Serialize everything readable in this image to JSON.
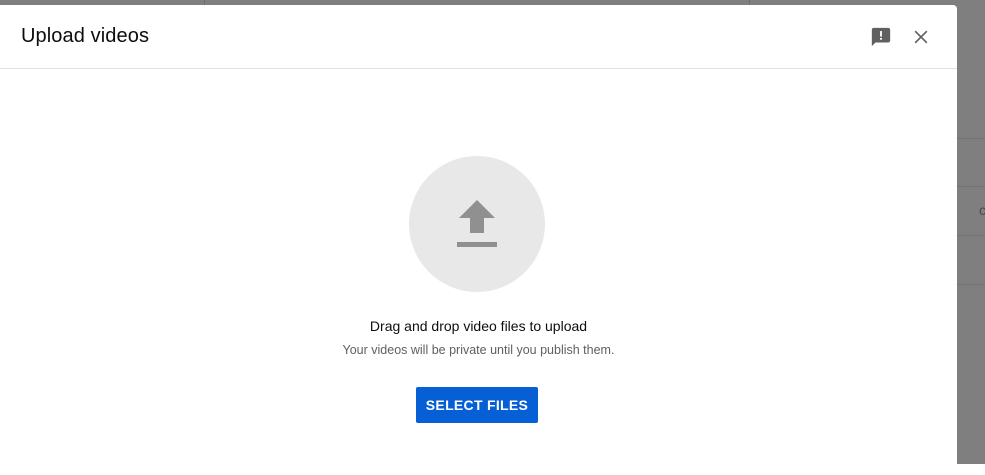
{
  "dialog": {
    "title": "Upload videos",
    "feedback_icon": "feedback-icon",
    "close_icon": "close-icon"
  },
  "dropzone": {
    "upload_icon": "upload-arrow-icon",
    "primary_text": "Drag and drop video files to upload",
    "secondary_text": "Your videos will be private until you publish them.",
    "select_button_label": "SELECT FILES"
  },
  "colors": {
    "accent": "#065fd4",
    "overlay": "#7f7f7f",
    "circle": "#e8e8e8",
    "icon": "#909090"
  }
}
